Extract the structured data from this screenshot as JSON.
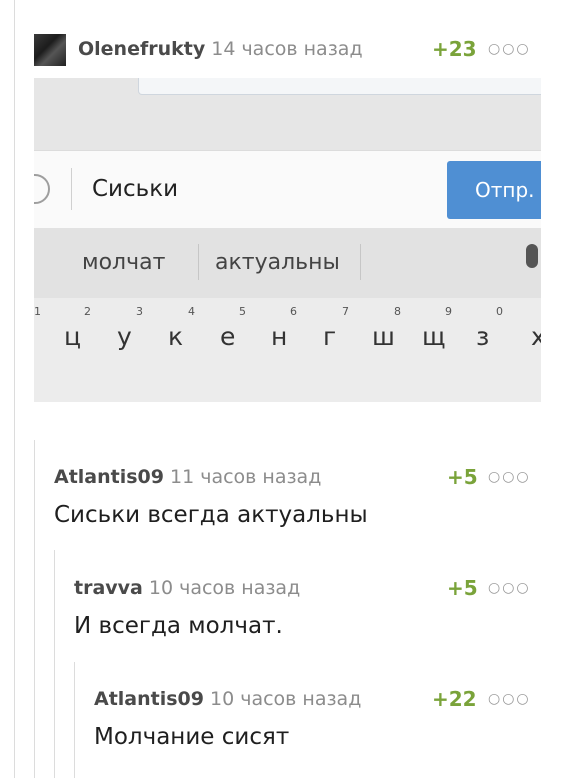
{
  "post": {
    "username": "Olenefrukty",
    "time": "14 часов назад",
    "score": "+23",
    "more": "○○○",
    "image": {
      "typed_text": "Сиськи",
      "send_button": "Отпр.",
      "suggestions": [
        "молчат",
        "актуальны"
      ],
      "keys": [
        "ц",
        "у",
        "к",
        "е",
        "н",
        "г",
        "ш",
        "щ",
        "з",
        "х"
      ],
      "key_numbers": [
        "1",
        "2",
        "3",
        "4",
        "5",
        "6",
        "7",
        "8",
        "9",
        "0"
      ]
    }
  },
  "comments": [
    {
      "username": "Atlantis09",
      "time": "11 часов назад",
      "score": "+5",
      "more": "○○○",
      "text": "Сиськи всегда актуальны"
    },
    {
      "username": "travva",
      "time": "10 часов назад",
      "score": "+5",
      "more": "○○○",
      "text": "И всегда молчат."
    },
    {
      "username": "Atlantis09",
      "time": "10 часов назад",
      "score": "+22",
      "more": "○○○",
      "text": "Молчание сисят"
    }
  ],
  "colors": {
    "score": "#7aa33a",
    "send_button": "#4f8fd3"
  }
}
